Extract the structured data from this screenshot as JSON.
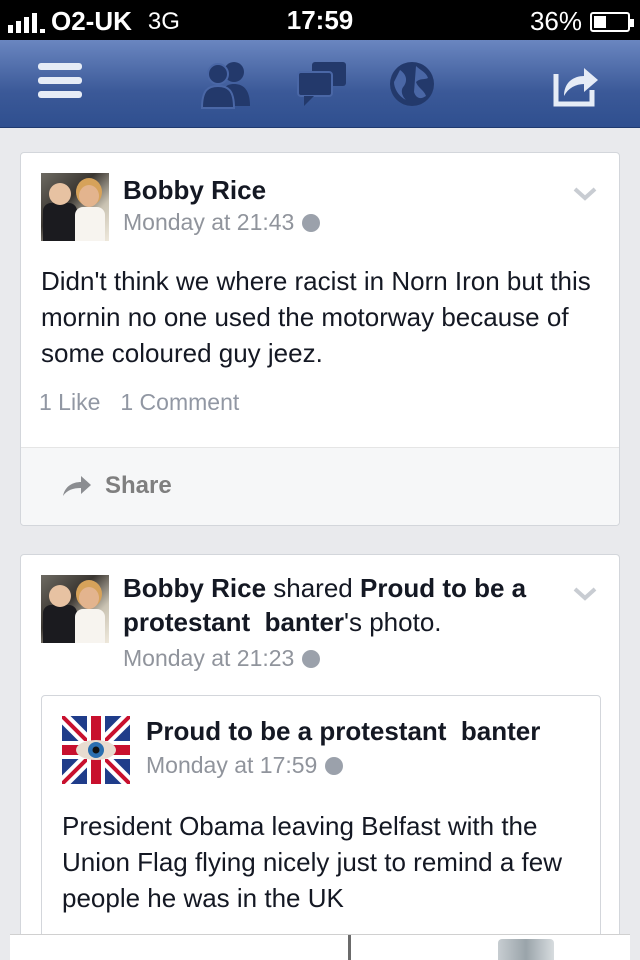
{
  "status_bar": {
    "carrier": "O2-UK",
    "network": "3G",
    "time": "17:59",
    "battery": "36%",
    "battery_level": 0.36
  },
  "navbar": {
    "icons": [
      "menu-icon",
      "friends-icon",
      "messages-icon",
      "globe-icon",
      "share-icon"
    ],
    "color": "#3b5998"
  },
  "posts": [
    {
      "author": "Bobby Rice",
      "timestamp": "Monday at 21:43",
      "text": "Didn't think we where racist in Norn Iron but this mornin no one used the motorway because of some coloured guy jeez.",
      "likes": "1 Like",
      "comments": "1 Comment",
      "share_label": "Share"
    },
    {
      "author": "Bobby Rice",
      "action": " shared ",
      "page_name": "Proud to be a protestant  banter",
      "suffix": "'s photo.",
      "timestamp": "Monday at 21:23",
      "shared": {
        "page_name": "Proud to be a protestant  banter",
        "timestamp": "Monday at 17:59",
        "text": "President Obama leaving Belfast with the Union Flag flying nicely just to remind a few people he was in the UK"
      }
    }
  ]
}
